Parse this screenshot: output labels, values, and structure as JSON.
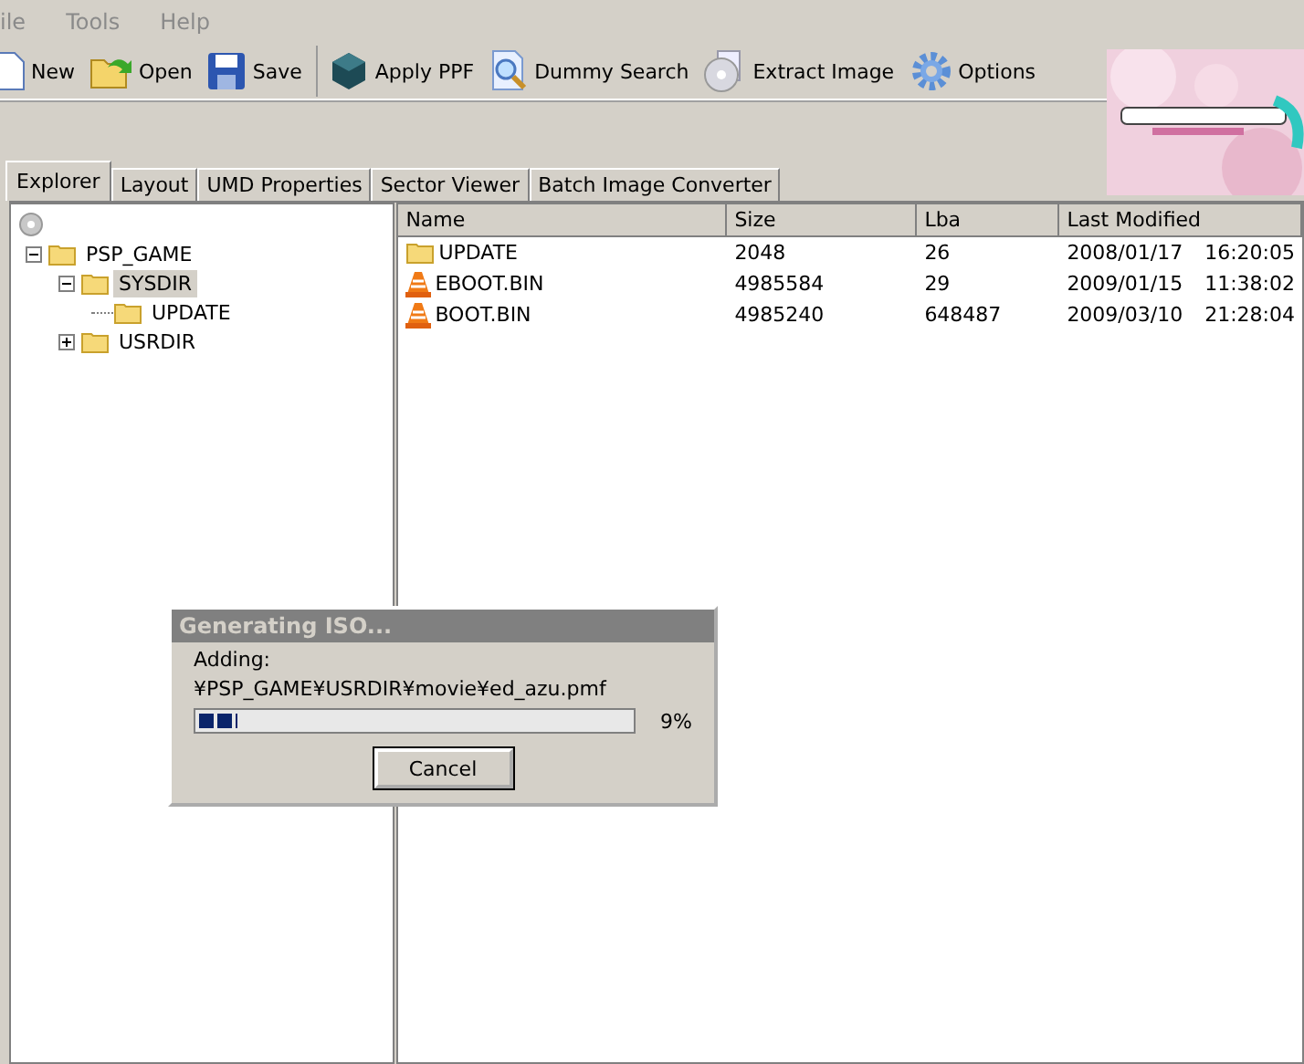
{
  "menu": [
    "ile",
    "Tools",
    "Help"
  ],
  "toolbar": [
    {
      "label": "New",
      "kind": "new"
    },
    {
      "label": "Open",
      "kind": "open"
    },
    {
      "label": "Save",
      "kind": "save"
    },
    {
      "label": "Apply PPF",
      "kind": "cube"
    },
    {
      "label": "Dummy Search",
      "kind": "search"
    },
    {
      "label": "Extract Image",
      "kind": "disc"
    },
    {
      "label": "Options",
      "kind": "gear"
    }
  ],
  "banner": {
    "kind": "picture"
  },
  "tabs": [
    {
      "label": "Explorer",
      "selected": true
    },
    {
      "label": "Layout",
      "selected": false
    },
    {
      "label": "UMD Properties",
      "selected": false
    },
    {
      "label": "Sector Viewer",
      "selected": false
    },
    {
      "label": "Batch Image Converter",
      "selected": false
    }
  ],
  "tree": {
    "kind": "disc",
    "children": [
      {
        "label": "PSP_GAME",
        "expanded": true,
        "selected": false,
        "children": [
          {
            "label": "SYSDIR",
            "expanded": true,
            "selected": true,
            "children": [
              {
                "label": "UPDATE",
                "selected": false
              }
            ]
          },
          {
            "label": "USRDIR",
            "expanded": false,
            "selected": false
          }
        ]
      }
    ]
  },
  "table": {
    "columns": [
      "Name",
      "Size",
      "Lba",
      "Last Modified"
    ],
    "rows": [
      {
        "kind": "folder",
        "name": "UPDATE",
        "size": "2048",
        "lba": "26",
        "date": "2008/01/17",
        "time": "16:20:05"
      },
      {
        "kind": "cone",
        "name": "EBOOT.BIN",
        "size": "4985584",
        "lba": "29",
        "date": "2009/01/15",
        "time": "11:38:02"
      },
      {
        "kind": "cone",
        "name": "BOOT.BIN",
        "size": "4985240",
        "lba": "648487",
        "date": "2009/03/10",
        "time": "21:28:04"
      }
    ]
  },
  "dialog": {
    "title": "Generating ISO...",
    "label": "Adding:",
    "path": "¥PSP_GAME¥USRDIR¥movie¥ed_azu.pmf",
    "level": 0.09,
    "percent": "9%",
    "button": "Cancel"
  }
}
